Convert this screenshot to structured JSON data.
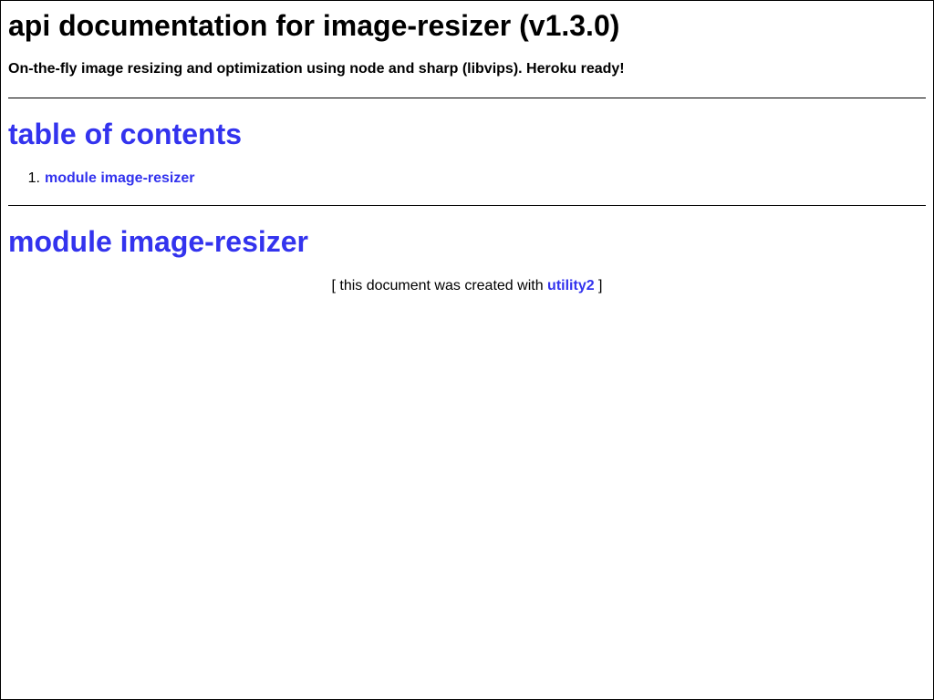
{
  "header": {
    "title": "api documentation for image-resizer (v1.3.0)",
    "description": "On-the-fly image resizing and optimization using node and sharp (libvips). Heroku ready!"
  },
  "toc": {
    "heading": "table of contents",
    "items": [
      {
        "number": "1.",
        "label": "module image-resizer"
      }
    ]
  },
  "module": {
    "heading": "module image-resizer"
  },
  "footer": {
    "prefix": "[ this document was created with ",
    "link_label": "utility2",
    "suffix": " ]"
  },
  "colors": {
    "link": "#3333ee",
    "text": "#000000",
    "background": "#ffffff"
  }
}
